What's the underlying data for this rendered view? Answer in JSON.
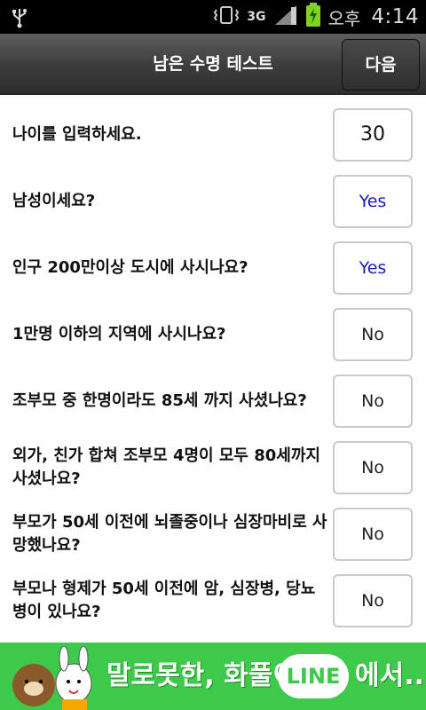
{
  "status_bar": {
    "network": "3G",
    "ampm": "오후",
    "time": "4:14",
    "icons": [
      "usb-icon",
      "vibrate-icon",
      "signal-icon",
      "battery-charging-icon"
    ]
  },
  "header": {
    "title": "남은 수명 테스트",
    "next_label": "다음"
  },
  "questions": [
    {
      "question": "나이를 입력하세요.",
      "answer": "30"
    },
    {
      "question": "남성이세요?",
      "answer": "Yes"
    },
    {
      "question": "인구 200만이상 도시에 사시나요?",
      "answer": "Yes"
    },
    {
      "question": "1만명 이하의 지역에 사시나요?",
      "answer": "No"
    },
    {
      "question": "조부모 중 한명이라도 85세 까지 사셨나요?",
      "answer": "No"
    },
    {
      "question": "외가, 친가 합쳐 조부모 4명이 모두 80세까지 사셨나요?",
      "answer": "No"
    },
    {
      "question": "부모가 50세 이전에 뇌졸중이나 심장마비로 사망했나요?",
      "answer": "No"
    },
    {
      "question": "부모나 형제가 50세 이전에 암, 심장병, 당뇨병이 있나요?",
      "answer": "No"
    }
  ],
  "ad": {
    "text": "말로못한, 화풀이",
    "logo": "LINE",
    "tail": "에서..",
    "colors": {
      "background": "#3ec94b",
      "yes_text": "#1b1bb5"
    }
  }
}
